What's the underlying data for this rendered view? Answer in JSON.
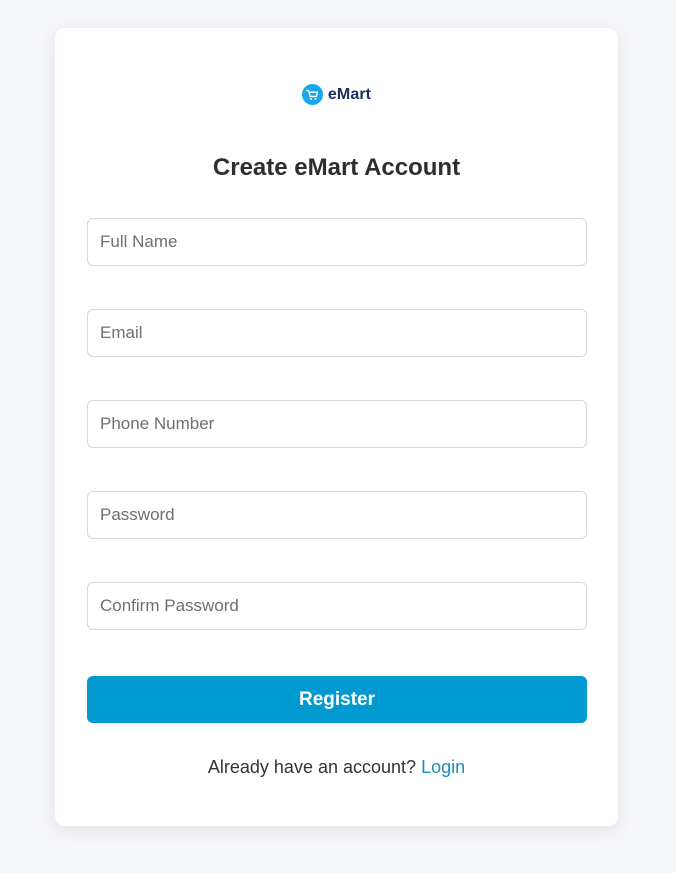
{
  "brand": {
    "name": "eMart",
    "icon": "cart-icon",
    "icon_color": "#16a8e8",
    "text_color": "#1b2f5e"
  },
  "title": "Create eMart Account",
  "fields": [
    {
      "name": "full-name-input",
      "placeholder": "Full Name",
      "value": "",
      "type": "text"
    },
    {
      "name": "email-input",
      "placeholder": "Email",
      "value": "",
      "type": "email"
    },
    {
      "name": "phone-number-input",
      "placeholder": "Phone Number",
      "value": "",
      "type": "tel"
    },
    {
      "name": "password-input",
      "placeholder": "Password",
      "value": "",
      "type": "password"
    },
    {
      "name": "confirm-password-input",
      "placeholder": "Confirm Password",
      "value": "",
      "type": "password"
    }
  ],
  "register_button": {
    "label": "Register",
    "color": "#0099d0"
  },
  "login_prompt": {
    "text": "Already have an account?",
    "link_label": "Login",
    "link_color": "#1a8fba"
  }
}
